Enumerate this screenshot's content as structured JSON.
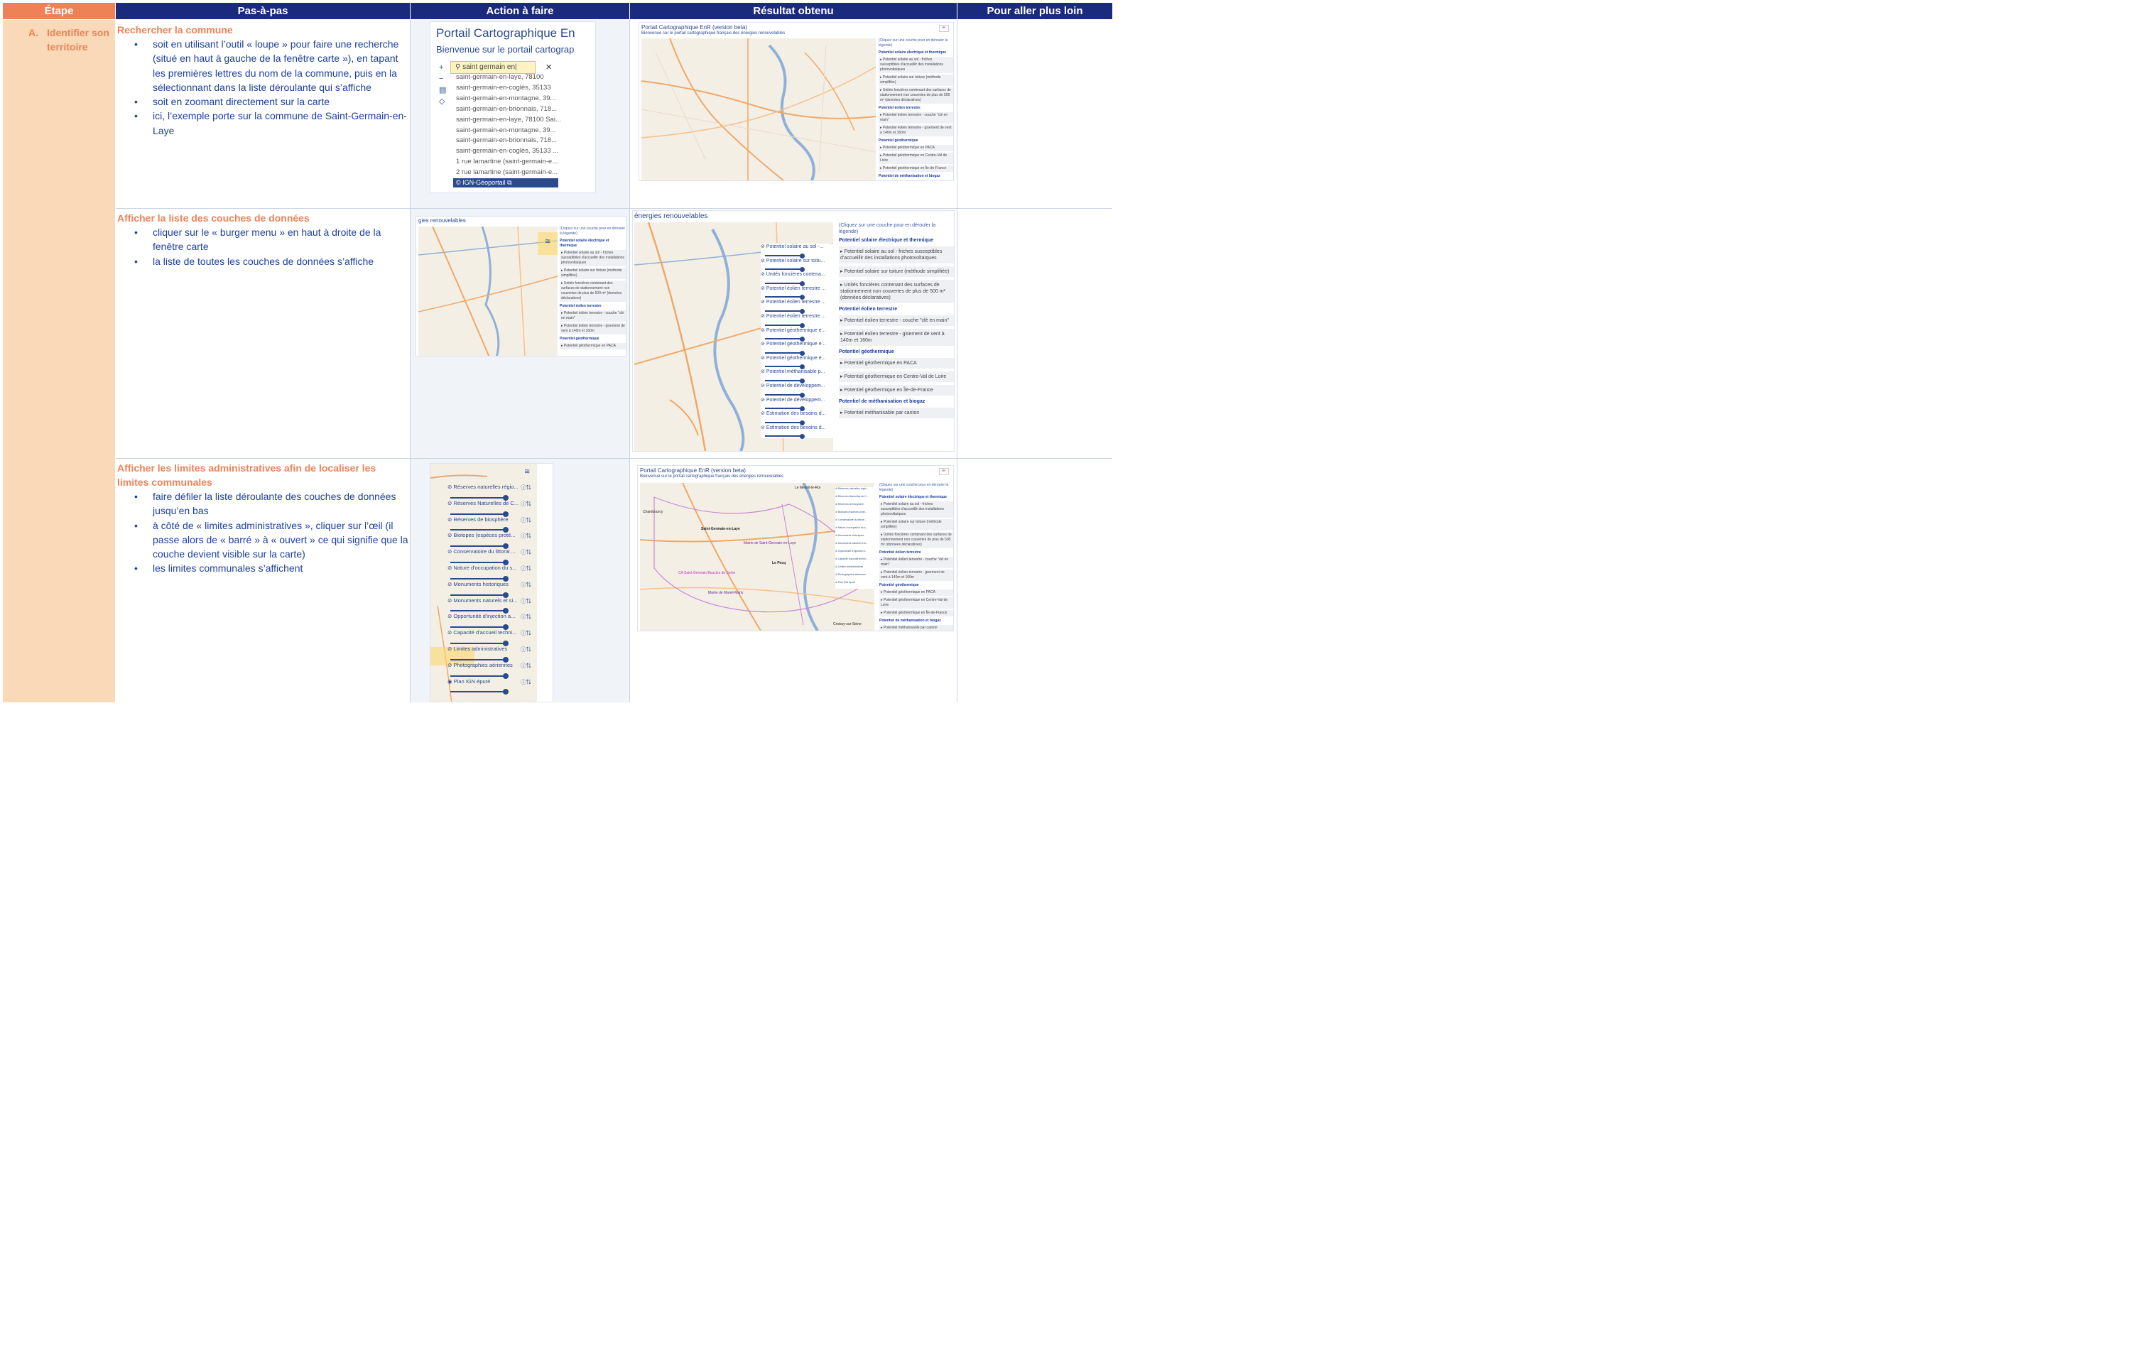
{
  "headers": {
    "etape": "Étape",
    "pas": "Pas-à-pas",
    "action": "Action à faire",
    "resultat": "Résultat obtenu",
    "plus": "Pour aller plus loin"
  },
  "etape": {
    "letter": "A.",
    "label": "Identifier son territoire"
  },
  "steps": [
    {
      "title": "Rechercher la commune",
      "bullets": [
        "soit en utilisant l’outil « loupe » pour faire une recherche (situé en haut à gauche de la fenêtre carte »), en tapant les premières lettres du nom de la commune, puis en la sélectionnant dans la liste déroulante qui s’affiche",
        "soit en zoomant directement sur la carte",
        "ici, l’exemple porte sur la commune de Saint-Germain-en-Laye"
      ]
    },
    {
      "title": "Afficher la liste des couches de données",
      "bullets": [
        "cliquer sur le « burger menu » en haut à droite de la fenêtre carte",
        "la liste de toutes les couches de données s’affiche"
      ]
    },
    {
      "title": "Afficher les limites administratives afin de localiser les limites communales",
      "bullets": [
        "faire défiler la liste déroulante des couches de données jusqu’en bas",
        "à côté de « limites administratives », cliquer sur l’œil (il passe alors de « barré » à « ouvert » ce qui signifie que la couche devient visible sur la carte)",
        "les limites communales s’affichent"
      ]
    }
  ],
  "shot1": {
    "title": "Portail Cartographique En",
    "subtitle": "Bienvenue sur le portail cartograp",
    "search_value": "saint germain en|",
    "suggestions": [
      "saint-germain-en-laye, 78100",
      "saint-germain-en-coglès, 35133",
      "saint-germain-en-montagne, 39...",
      "saint-germain-en-brionnais, 718...",
      "saint-germain-en-laye, 78100 Sai...",
      "saint-germain-en-montagne, 39...",
      "saint-germain-en-brionnais, 718...",
      "saint-germain-en-coglès, 35133 ...",
      "1 rue lamartine (saint-germain-e...",
      "2 rue lamartine (saint-germain-e..."
    ],
    "ign": "© IGN-Géoportail ⧉"
  },
  "portal": {
    "title": "Portail Cartographique EnR (version beta)",
    "subtitle": "Bienvenue sur le portail cartographique français des énergies renouvelables",
    "subtitle_crop_small": "gies renouvelables",
    "subtitle_crop_large": "énergies renouvelables"
  },
  "legend": {
    "hint": "(Cliquez sur une couche pour en dérouler la légende)",
    "sections": [
      {
        "title": "Potentiel solaire électrique et thermique",
        "items": [
          "Potentiel solaire au sol - friches susceptibles d'accueillir des installations photovoltaïques",
          "Potentiel solaire sur toiture (méthode simplifiée)",
          "Unités foncières contenant des surfaces de stationnement non couvertes de plus de 500 m² (données déclaratives)"
        ]
      },
      {
        "title": "Potentiel éolien terrestre",
        "items": [
          "Potentiel éolien terrestre - couche \"clé en main\"",
          "Potentiel éolien terrestre - gisement de vent à 140m et 160m"
        ]
      },
      {
        "title": "Potentiel géothermique",
        "items": [
          "Potentiel géothermique en PACA",
          "Potentiel géothermique en Centre-Val de Loire",
          "Potentiel géothermique en Île-de-France"
        ]
      },
      {
        "title": "Potentiel de méthanisation et biogaz",
        "items": [
          "Potentiel méthanisable par canton"
        ]
      }
    ]
  },
  "layers_mid": [
    "Potentiel solaire au sol -...",
    "Potentiel solaire sur toitu...",
    "Unités foncières contena...",
    "Potentiel éolien terrestre ...",
    "Potentiel éolien terrestre ...",
    "Potentiel éolien terrestre ...",
    "Potentiel géothermique e...",
    "Potentiel géothermique e...",
    "Potentiel géothermique e...",
    "Potentiel méthanisable p...",
    "Potentiel de développem...",
    "Potentiel de développem...",
    "Estimation des besoins d...",
    "Estimation des besoins d..."
  ],
  "layers_bottom": [
    "Réserves naturelles régio...",
    "Réserves Naturelles de C...",
    "Réserves de biosphère",
    "Biotopes (espèces proté...",
    "Conservatoire du littoral ...",
    "Nature d'occupation du s...",
    "Monuments historiques",
    "Monuments naturels et si...",
    "Opportunité d'injection a...",
    "Capacité d'accueil techni...",
    "Limites administratives",
    "Photographies aériennes",
    "Plan IGN épuré"
  ],
  "map_labels": {
    "saint_germain": "Saint-Germain-en-Laye",
    "mairie": "Mairie de Saint-Germain-en-Laye",
    "le_pecq": "Le Pecq",
    "marly": "Mairie de Mareil-Marly",
    "ca": "CA Saint Germain Boucles de Seine",
    "mesnil": "Le Mesnil-le-Roi",
    "chambourcy": "Chambourcy",
    "croissy": "Croissy-sur-Seine"
  },
  "colors": {
    "orange": "#ee8256",
    "navy": "#1a2a7c",
    "peach": "#f9d9b8",
    "blue_text": "#1d3fa0",
    "map_road": "#f0a868",
    "map_water": "#8fb0d8"
  }
}
